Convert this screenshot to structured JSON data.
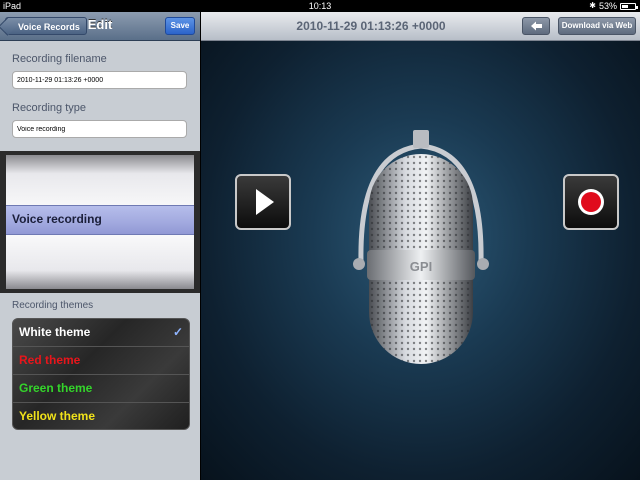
{
  "status_bar": {
    "device": "iPad",
    "time": "10:13",
    "battery": "53%",
    "bluetooth_icon": "bluetooth-icon"
  },
  "left_panel": {
    "back_button": "Voice Records",
    "title": "Edit",
    "save_button": "Save",
    "filename_label": "Recording filename",
    "filename_value": "2010-11-29 01:13:26 +0000",
    "type_label": "Recording type",
    "type_value": "Voice recording",
    "picker_selected": "Voice recording",
    "themes_label": "Recording themes",
    "themes": [
      {
        "label": "White theme",
        "color": "#ffffff",
        "selected": true
      },
      {
        "label": "Red theme",
        "color": "#e8151b",
        "selected": false
      },
      {
        "label": "Green theme",
        "color": "#34d42b",
        "selected": false
      },
      {
        "label": "Yellow theme",
        "color": "#f0e21a",
        "selected": false
      }
    ]
  },
  "right_panel": {
    "title": "2010-11-29 01:13:26 +0000",
    "share_icon": "reply-arrow-icon",
    "download_button": "Download via Web",
    "mic_logo": "GPI",
    "play_icon": "play-icon",
    "record_icon": "record-icon"
  }
}
